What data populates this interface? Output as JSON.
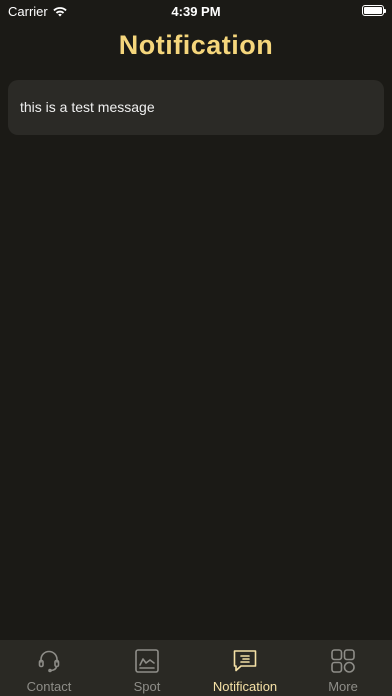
{
  "status_bar": {
    "carrier": "Carrier",
    "time": "4:39 PM"
  },
  "header": {
    "title": "Notification"
  },
  "messages": [
    {
      "text": "this is a test message"
    }
  ],
  "tab_bar": {
    "tabs": [
      {
        "label": "Contact",
        "icon": "headset-icon",
        "active": false
      },
      {
        "label": "Spot",
        "icon": "spot-card-icon",
        "active": false
      },
      {
        "label": "Notification",
        "icon": "message-icon",
        "active": true
      },
      {
        "label": "More",
        "icon": "grid-icon",
        "active": false
      }
    ]
  },
  "colors": {
    "background": "#1b1a16",
    "accent": "#f5d67c",
    "card": "#2b2a26",
    "tab_bar": "#2a2924",
    "tab_inactive": "#8e8d88",
    "tab_active": "#f5e1a6"
  }
}
